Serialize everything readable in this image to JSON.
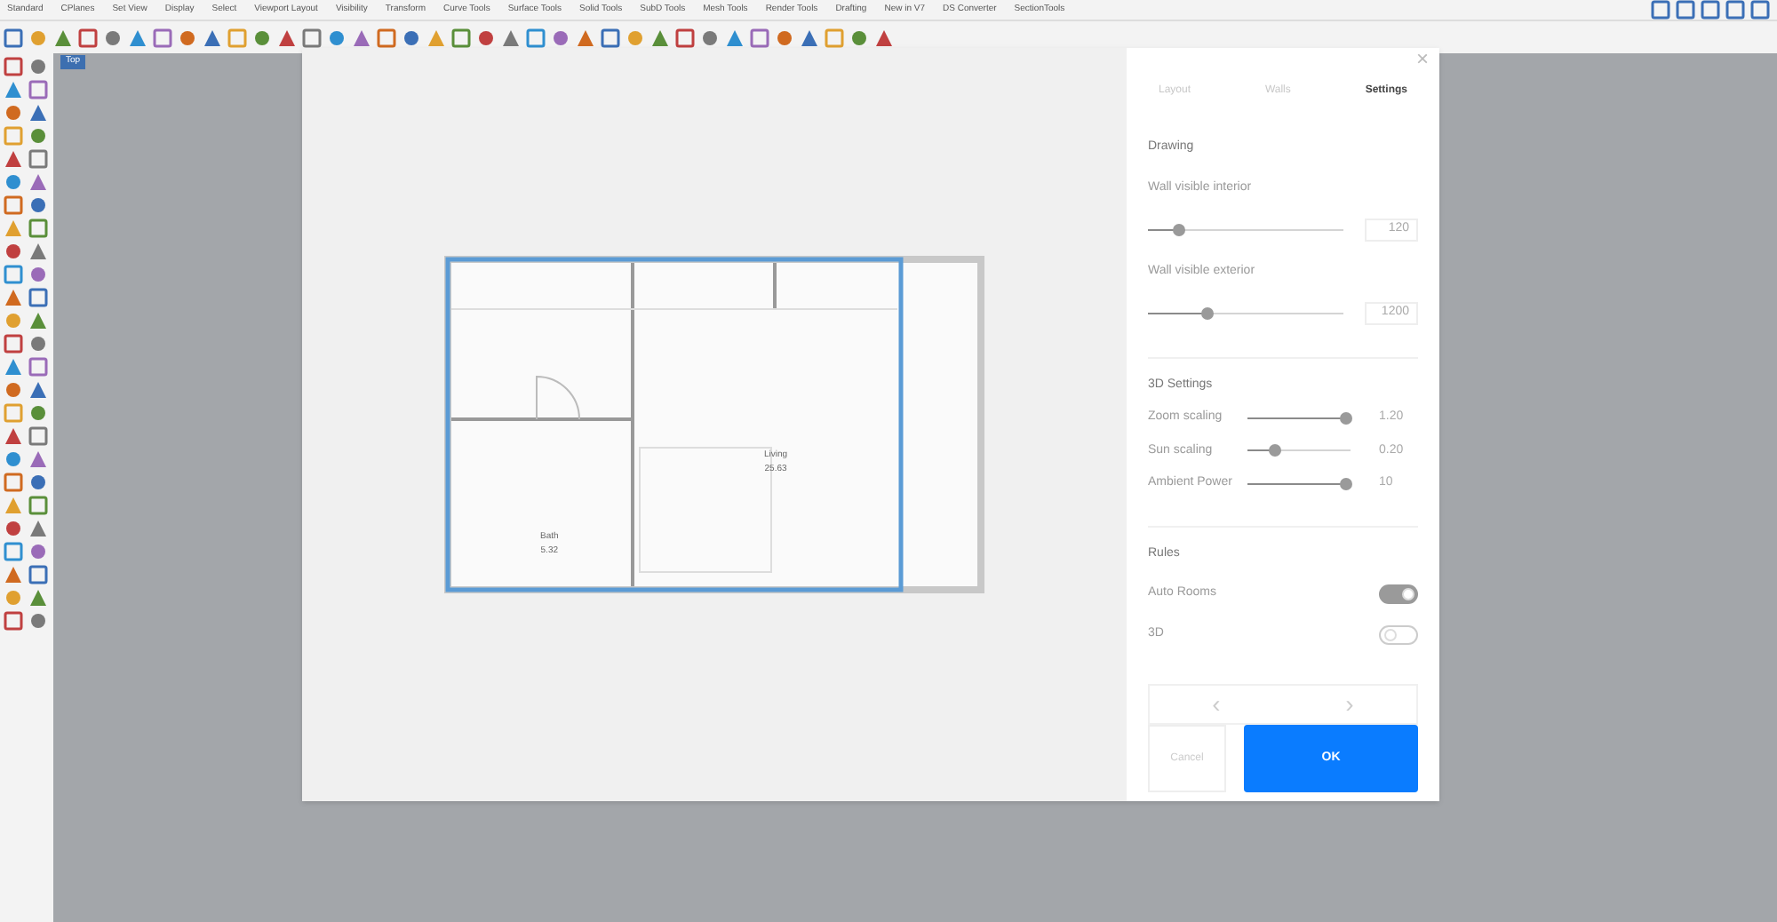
{
  "toolbar_tabs": [
    "Standard",
    "CPlanes",
    "Set View",
    "Display",
    "Select",
    "Viewport Layout",
    "Visibility",
    "Transform",
    "Curve Tools",
    "Surface Tools",
    "Solid Tools",
    "SubD Tools",
    "Mesh Tools",
    "Render Tools",
    "Drafting",
    "New in V7",
    "DS Converter",
    "SectionTools"
  ],
  "viewport": {
    "label": "Top"
  },
  "dialog": {
    "close": "×",
    "tabs": [
      {
        "label": "Layout",
        "selected": false
      },
      {
        "label": "Walls",
        "selected": false
      },
      {
        "label": "Settings",
        "selected": true
      }
    ],
    "sections": [
      {
        "title": "Drawing",
        "rows": [
          {
            "kind": "stacked-slider",
            "label": "Wall visible interior",
            "level": 0.15,
            "value": "120"
          },
          {
            "kind": "stacked-slider",
            "label": "Wall visible exterior",
            "level": 0.3,
            "value": "1200"
          }
        ]
      },
      {
        "title": "3D Settings",
        "rows": [
          {
            "kind": "inline-slider",
            "label": "Zoom scaling",
            "level": 0.95,
            "value": "1.20"
          },
          {
            "kind": "inline-slider",
            "label": "Sun scaling",
            "level": 0.25,
            "value": "0.20"
          },
          {
            "kind": "inline-slider",
            "label": "Ambient Power",
            "level": 0.95,
            "value": "10"
          }
        ]
      },
      {
        "title": "Rules",
        "rows": [
          {
            "kind": "toggle",
            "label": "Auto Rooms",
            "on": true
          },
          {
            "kind": "toggle",
            "label": "3D",
            "on": false
          }
        ]
      }
    ],
    "pager": {
      "prev": "‹",
      "next": "›"
    },
    "buttons": {
      "cancel": "Cancel",
      "ok": "OK"
    },
    "plan": {
      "rooms": [
        {
          "name": "Living",
          "area": "25.63"
        },
        {
          "name": "Bath",
          "area": "5.32"
        }
      ]
    }
  }
}
